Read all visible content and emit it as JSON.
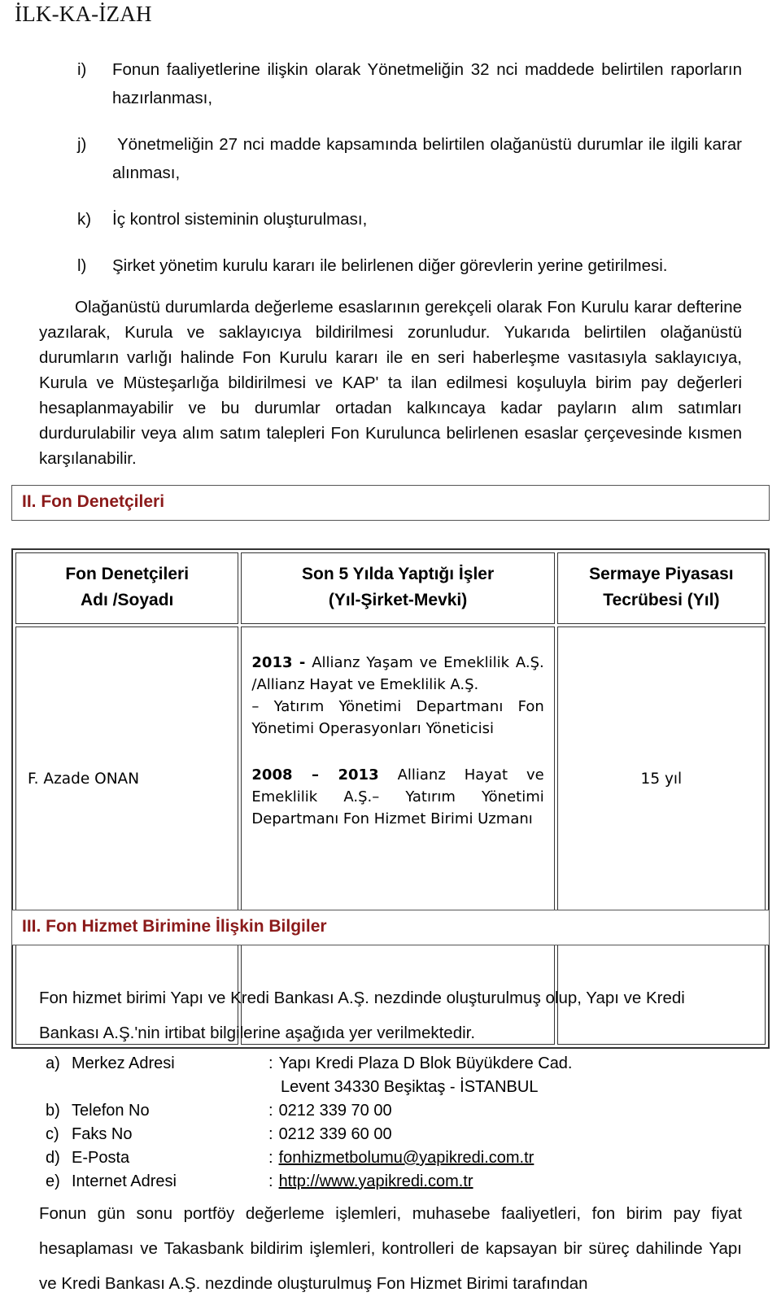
{
  "document": {
    "title": "İLK-KA-İZAH",
    "accent_color": "#8B1A1A",
    "text_color": "#0a0a0a"
  },
  "clauses": [
    {
      "marker": "i)",
      "text": "Fonun faaliyetlerine ilişkin olarak Yönetmeliğin 32 nci maddede belirtilen raporların hazırlanması,"
    },
    {
      "marker": "j)",
      "text": "Yönetmeliğin 27 nci madde kapsamında belirtilen olağanüstü durumlar ile ilgili karar alınması,"
    },
    {
      "marker": "k)",
      "text": "İç kontrol sisteminin oluşturulması,"
    },
    {
      "marker": "l)",
      "text": "Şirket yönetim kurulu kararı ile belirlenen diğer görevlerin yerine getirilmesi."
    }
  ],
  "paragraphs": {
    "olaganustu": "Olağanüstü durumlarda değerleme esaslarının gerekçeli olarak Fon Kurulu karar defterine yazılarak, Kurula ve saklayıcıya bildirilmesi zorunludur. Yukarıda belirtilen olağanüstü durumların varlığı halinde Fon Kurulu kararı ile en seri haberleşme vasıtasıyla saklayıcıya, Kurula ve Müsteşarlığa bildirilmesi ve KAP' ta ilan edilmesi koşuluyla birim pay değerleri hesaplanmayabilir ve bu durumlar ortadan kalkıncaya kadar payların alım satımları durdurulabilir veya alım satım talepleri Fon Kurulunca belirlenen esaslar çerçevesinde kısmen karşılanabilir.",
    "fon_hizmet_intro": "Fon hizmet birimi Yapı ve Kredi Bankası A.Ş. nezdinde oluşturulmuş olup, Yapı ve Kredi Bankası A.Ş.'nin irtibat bilgilerine aşağıda yer verilmektedir.",
    "gun_sonu": "Fonun gün sonu portföy değerleme işlemleri, muhasebe faaliyetleri, fon birim pay fiyat hesaplaması ve Takasbank bildirim işlemleri, kontrolleri de kapsayan bir süreç dahilinde Yapı ve Kredi Bankası A.Ş. nezdinde oluşturulmuş Fon Hizmet Birimi tarafından"
  },
  "sections": {
    "ii": {
      "heading": "II. Fon Denetçileri"
    },
    "iii": {
      "heading": "III. Fon Hizmet Birimine İlişkin Bilgiler"
    }
  },
  "auditors_table": {
    "headers": [
      "Fon Denetçileri\nAdı /Soyadı",
      "Son 5 Yılda Yaptığı İşler\n(Yıl-Şirket-Mevki)",
      "Sermaye Piyasası\nTecrübesi (Yıl)"
    ],
    "rows": [
      {
        "name": "F. Azade ONAN",
        "jobs": [
          {
            "years": "2013 -",
            "detail": "Allianz Yaşam ve Emeklilik A.Ş. /Allianz Hayat ve Emeklilik A.Ş.",
            "tail": "– Yatırım Yönetimi Departmanı Fon Yönetimi Operasyonları Yöneticisi"
          },
          {
            "years": "2008 – 2013",
            "detail": "Allianz Hayat ve Emeklilik A.Ş.– Yatırım Yönetimi Departmanı Fon Hizmet Birimi Uzmanı",
            "tail": ""
          }
        ],
        "experience": "15 yıl"
      }
    ]
  },
  "contact": {
    "items": [
      {
        "marker": "a)",
        "label": "Merkez Adresi",
        "value": "Yapı Kredi Plaza D Blok Büyükdere Cad.",
        "value_line2": "Levent 34330 Beşiktaş - İSTANBUL",
        "link": false
      },
      {
        "marker": "b)",
        "label": "Telefon No",
        "value": "0212 339 70 00",
        "link": false
      },
      {
        "marker": "c)",
        "label": "Faks No",
        "value": "0212 339 60 00",
        "link": false
      },
      {
        "marker": "d)",
        "label": "E-Posta",
        "value": "fonhizmetbolumu@yapikredi.com.tr",
        "link": true
      },
      {
        "marker": "e)",
        "label": "Internet Adresi",
        "value": "http://www.yapikredi.com.tr",
        "link": true
      }
    ],
    "colon": ":"
  }
}
